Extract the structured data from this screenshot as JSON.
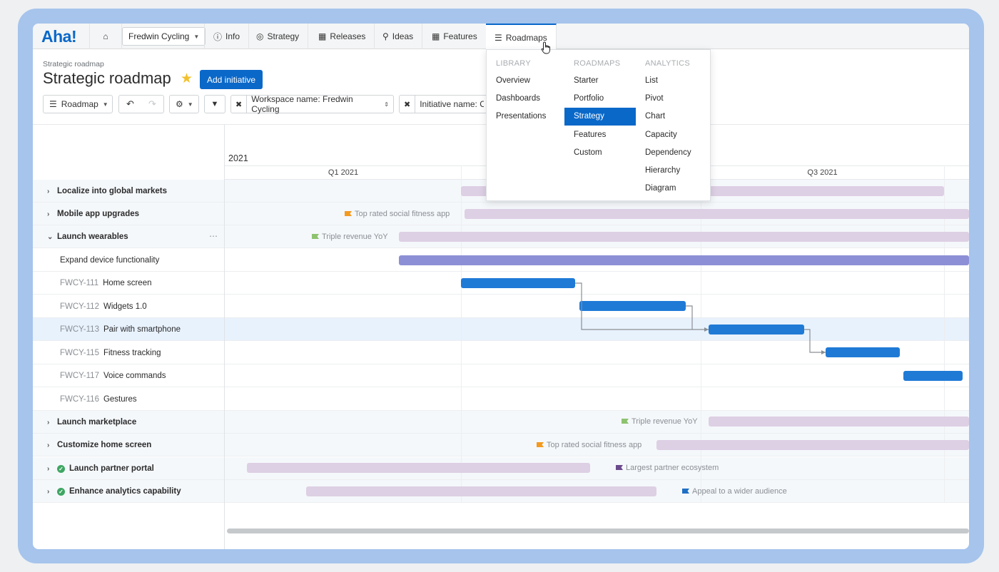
{
  "app": {
    "logo": "Aha!",
    "workspace": "Fredwin Cycling",
    "nav": [
      {
        "label": "Info",
        "icon": "info-icon"
      },
      {
        "label": "Strategy",
        "icon": "target-icon"
      },
      {
        "label": "Releases",
        "icon": "calendar-icon"
      },
      {
        "label": "Ideas",
        "icon": "lightbulb-icon"
      },
      {
        "label": "Features",
        "icon": "grid-icon"
      },
      {
        "label": "Roadmaps",
        "icon": "roadmap-icon"
      }
    ]
  },
  "header": {
    "breadcrumb": "Strategic roadmap",
    "title": "Strategic roadmap",
    "add_button": "Add initiative"
  },
  "toolbar": {
    "view": "Roadmap",
    "filter_workspace": "Workspace name: Fredwin Cycling",
    "filter_initiative": "Initiative name: C"
  },
  "timeline": {
    "year": "2021",
    "quarters": [
      "Q1 2021",
      "Q3 2021"
    ]
  },
  "rows": [
    {
      "label": "Localize into global markets",
      "type": "initiative"
    },
    {
      "label": "Mobile app upgrades",
      "type": "initiative",
      "goal": "Top rated social fitness app",
      "goal_color": "#f39a1f"
    },
    {
      "label": "Launch wearables",
      "type": "initiative",
      "expanded": true,
      "goal": "Triple revenue YoY",
      "goal_color": "#8dc26f"
    },
    {
      "label": "Expand device functionality",
      "type": "epic"
    },
    {
      "key": "FWCY-111",
      "label": "Home screen",
      "type": "feature"
    },
    {
      "key": "FWCY-112",
      "label": "Widgets 1.0",
      "type": "feature"
    },
    {
      "key": "FWCY-113",
      "label": "Pair with smartphone",
      "type": "feature"
    },
    {
      "key": "FWCY-115",
      "label": "Fitness tracking",
      "type": "feature"
    },
    {
      "key": "FWCY-117",
      "label": "Voice commands",
      "type": "feature"
    },
    {
      "key": "FWCY-116",
      "label": "Gestures",
      "type": "feature"
    },
    {
      "label": "Launch marketplace",
      "type": "initiative",
      "goal": "Triple revenue YoY",
      "goal_color": "#8dc26f"
    },
    {
      "label": "Customize home screen",
      "type": "initiative",
      "goal": "Top rated social fitness app",
      "goal_color": "#f39a1f"
    },
    {
      "label": "Launch partner portal",
      "type": "initiative",
      "done": true,
      "goal": "Largest partner ecosystem",
      "goal_color": "#6b4a8c"
    },
    {
      "label": "Enhance analytics capability",
      "type": "initiative",
      "done": true,
      "goal": "Appeal to a wider audience",
      "goal_color": "#1f6fc4"
    }
  ],
  "dropdown": {
    "library": {
      "header": "LIBRARY",
      "items": [
        "Overview",
        "Dashboards",
        "Presentations"
      ]
    },
    "roadmaps": {
      "header": "ROADMAPS",
      "items": [
        "Starter",
        "Portfolio",
        "Strategy",
        "Features",
        "Custom"
      ],
      "active": "Strategy"
    },
    "analytics": {
      "header": "ANALYTICS",
      "items": [
        "List",
        "Pivot",
        "Chart",
        "Capacity",
        "Dependency",
        "Hierarchy",
        "Diagram"
      ]
    }
  },
  "colors": {
    "accent": "#0a68c9",
    "initiative_bar": "#ddcfe4",
    "feature_bar": "#1f7ad6",
    "epic_bar": "#8d8fd6"
  }
}
